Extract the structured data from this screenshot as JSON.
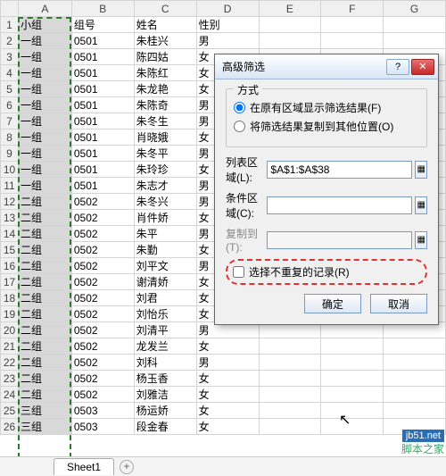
{
  "columns": [
    "A",
    "B",
    "C",
    "D",
    "E",
    "F",
    "G"
  ],
  "headers": {
    "A": "小组",
    "B": "组号",
    "C": "姓名",
    "D": "性别"
  },
  "rows": [
    {
      "n": 1,
      "A": "小组",
      "B": "组号",
      "C": "姓名",
      "D": "性别"
    },
    {
      "n": 2,
      "A": "一组",
      "B": "0501",
      "C": "朱桂兴",
      "D": "男"
    },
    {
      "n": 3,
      "A": "一组",
      "B": "0501",
      "C": "陈四姑",
      "D": "女"
    },
    {
      "n": 4,
      "A": "一组",
      "B": "0501",
      "C": "朱陈红",
      "D": "女"
    },
    {
      "n": 5,
      "A": "一组",
      "B": "0501",
      "C": "朱龙艳",
      "D": "女"
    },
    {
      "n": 6,
      "A": "一组",
      "B": "0501",
      "C": "朱陈奇",
      "D": "男"
    },
    {
      "n": 7,
      "A": "一组",
      "B": "0501",
      "C": "朱冬生",
      "D": "男"
    },
    {
      "n": 8,
      "A": "一组",
      "B": "0501",
      "C": "肖晓娥",
      "D": "女"
    },
    {
      "n": 9,
      "A": "一组",
      "B": "0501",
      "C": "朱冬平",
      "D": "男"
    },
    {
      "n": 10,
      "A": "一组",
      "B": "0501",
      "C": "朱玲珍",
      "D": "女"
    },
    {
      "n": 11,
      "A": "一组",
      "B": "0501",
      "C": "朱志才",
      "D": "男"
    },
    {
      "n": 12,
      "A": "二组",
      "B": "0502",
      "C": "朱冬兴",
      "D": "男"
    },
    {
      "n": 13,
      "A": "二组",
      "B": "0502",
      "C": "肖件娇",
      "D": "女"
    },
    {
      "n": 14,
      "A": "二组",
      "B": "0502",
      "C": "朱平",
      "D": "男"
    },
    {
      "n": 15,
      "A": "二组",
      "B": "0502",
      "C": "朱勤",
      "D": "女"
    },
    {
      "n": 16,
      "A": "二组",
      "B": "0502",
      "C": "刘平文",
      "D": "男"
    },
    {
      "n": 17,
      "A": "二组",
      "B": "0502",
      "C": "谢清娇",
      "D": "女"
    },
    {
      "n": 18,
      "A": "二组",
      "B": "0502",
      "C": "刘君",
      "D": "女"
    },
    {
      "n": 19,
      "A": "二组",
      "B": "0502",
      "C": "刘怡乐",
      "D": "女"
    },
    {
      "n": 20,
      "A": "二组",
      "B": "0502",
      "C": "刘清平",
      "D": "男"
    },
    {
      "n": 21,
      "A": "二组",
      "B": "0502",
      "C": "龙发兰",
      "D": "女"
    },
    {
      "n": 22,
      "A": "二组",
      "B": "0502",
      "C": "刘科",
      "D": "男"
    },
    {
      "n": 23,
      "A": "二组",
      "B": "0502",
      "C": "杨玉香",
      "D": "女"
    },
    {
      "n": 24,
      "A": "二组",
      "B": "0502",
      "C": "刘雅洁",
      "D": "女"
    },
    {
      "n": 25,
      "A": "三组",
      "B": "0503",
      "C": "杨运娇",
      "D": "女"
    },
    {
      "n": 26,
      "A": "三组",
      "B": "0503",
      "C": "段金春",
      "D": "女"
    }
  ],
  "sheetTab": "Sheet1",
  "dialog": {
    "title": "高级筛选",
    "help": "?",
    "close": "✕",
    "group": "方式",
    "opt1": "在原有区域显示筛选结果(F)",
    "opt2": "将筛选结果复制到其他位置(O)",
    "listLabel": "列表区域(L):",
    "listValue": "$A$1:$A$38",
    "critLabel": "条件区域(C):",
    "critValue": "",
    "copyLabel": "复制到(T):",
    "copyValue": "",
    "uniqueLabel": "选择不重复的记录(R)",
    "ok": "确定",
    "cancel": "取消",
    "refIcon": "▦"
  },
  "watermark": {
    "top": "jb51.net",
    "bottom": "脚本之家"
  }
}
